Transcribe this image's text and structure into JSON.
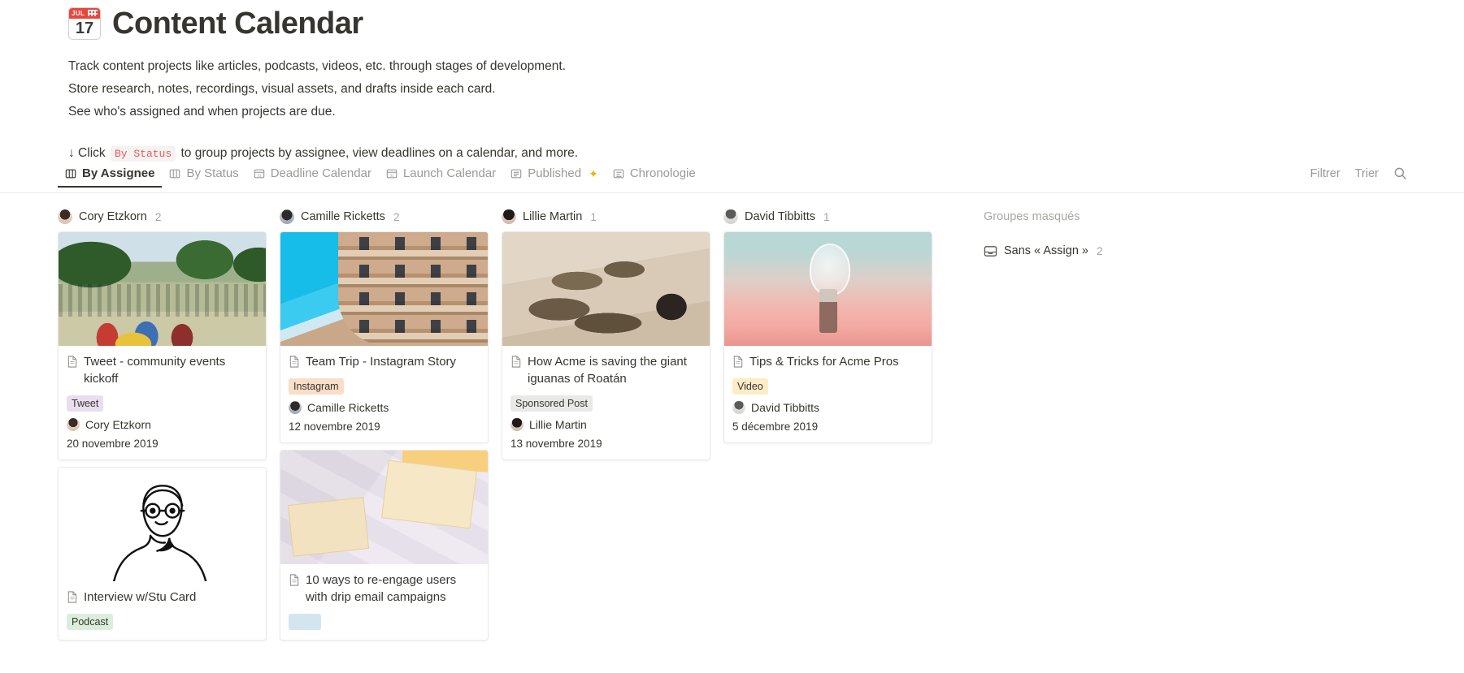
{
  "header": {
    "emoji_name": "calendar-emoji",
    "emoji_month": "JUL",
    "emoji_day": "17",
    "title": "Content Calendar",
    "description": [
      "Track content projects like articles, podcasts, videos, etc. through stages of development.",
      "Store research, notes, recordings, visual assets, and drafts inside each card.",
      "See who's assigned and when projects are due."
    ],
    "hint_prefix": "↓ Click",
    "hint_chip": "By Status",
    "hint_suffix": "to group projects by assignee, view deadlines on a calendar, and more."
  },
  "tabs": [
    {
      "label": "By Assignee",
      "icon": "board-view-icon",
      "active": true,
      "sparkle": false
    },
    {
      "label": "By Status",
      "icon": "board-view-icon",
      "active": false,
      "sparkle": false
    },
    {
      "label": "Deadline Calendar",
      "icon": "calendar-view-icon",
      "active": false,
      "sparkle": false
    },
    {
      "label": "Launch Calendar",
      "icon": "calendar-view-icon",
      "active": false,
      "sparkle": false
    },
    {
      "label": "Published",
      "icon": "gallery-view-icon",
      "active": false,
      "sparkle": true
    },
    {
      "label": "Chronologie",
      "icon": "timeline-view-icon",
      "active": false,
      "sparkle": false
    }
  ],
  "toolbar": {
    "filter_label": "Filtrer",
    "sort_label": "Trier",
    "search_icon": "search-icon"
  },
  "board": {
    "columns": [
      {
        "name": "Cory Etzkorn",
        "count": "2",
        "avatar": "av-cory",
        "cards": [
          {
            "title": "Tweet - community events kickoff",
            "tag": "Tweet",
            "tag_class": "tag-tweet",
            "person": "Cory Etzkorn",
            "avatar": "av-cory",
            "date": "20 novembre 2019",
            "image": "img-festival",
            "image_name": "festival-crowd-photo"
          },
          {
            "title": "Interview w/Stu Card",
            "tag": "Podcast",
            "tag_class": "tag-podcast",
            "person": "",
            "avatar": "av-cory",
            "date": "",
            "image": "img-illustration",
            "image_name": "man-line-drawing-illustration"
          }
        ]
      },
      {
        "name": "Camille Ricketts",
        "count": "2",
        "avatar": "av-camille",
        "cards": [
          {
            "title": "Team Trip - Instagram Story",
            "tag": "Instagram",
            "tag_class": "tag-instagram",
            "person": "Camille Ricketts",
            "avatar": "av-camille",
            "date": "12 novembre 2019",
            "image": "img-casamila",
            "image_name": "casa-mila-building-photo"
          },
          {
            "title": "10 ways to re-engage users with drip email campaigns",
            "tag": "",
            "tag_class": "tag-email",
            "person": "",
            "avatar": "av-camille",
            "date": "",
            "image": "img-envelopes",
            "image_name": "paper-envelopes-photo"
          }
        ]
      },
      {
        "name": "Lillie Martin",
        "count": "1",
        "avatar": "av-lillie",
        "cards": [
          {
            "title": "How Acme is saving the giant iguanas of Roatán",
            "tag": "Sponsored Post",
            "tag_class": "tag-sponsored",
            "person": "Lillie Martin",
            "avatar": "av-lillie",
            "date": "13 novembre 2019",
            "image": "img-iguanas",
            "image_name": "iguanas-on-sand-photo"
          }
        ]
      },
      {
        "name": "David Tibbitts",
        "count": "1",
        "avatar": "av-david",
        "cards": [
          {
            "title": "Tips & Tricks for Acme Pros",
            "tag": "Video",
            "tag_class": "tag-video",
            "person": "David Tibbitts",
            "avatar": "av-david",
            "date": "5 décembre 2019",
            "image": "img-lightbulb",
            "image_name": "lightbulb-sunset-photo"
          }
        ]
      }
    ],
    "hidden_groups": {
      "title": "Groupes masqués",
      "item_label": "Sans « Assign »",
      "item_count": "2",
      "item_icon": "tray-icon"
    }
  },
  "colors": {
    "text": "#37352f",
    "muted": "#9b9a97",
    "border": "#eceae7",
    "code_accent": "#eb5757",
    "sparkle": "#eab308"
  }
}
